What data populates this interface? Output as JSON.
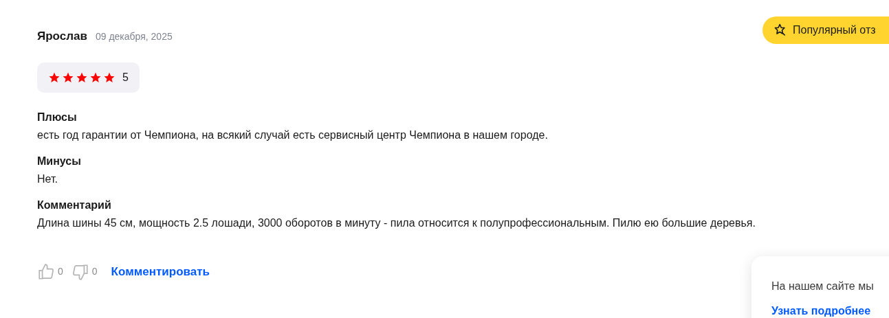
{
  "review": {
    "author": "Ярослав",
    "date": "09 декабря, 2025",
    "badge": "Популярный отз",
    "stars": 5,
    "rating": "5",
    "sections": [
      {
        "title": "Плюсы",
        "text": "есть год гарантии от Чемпиона, на всякий случай есть сервисный центр Чемпиона в нашем городе."
      },
      {
        "title": "Минусы",
        "text": "Нет."
      },
      {
        "title": "Комментарий",
        "text": "Длина шины 45 см, мощность 2.5 лошади, 3000 оборотов в минуту - пила относится к полупрофессиональным. Пилю ею большие деревья."
      }
    ],
    "likes": "0",
    "dislikes": "0",
    "comment_link": "Комментировать"
  },
  "cookie_notice": {
    "text": "На нашем сайте мы",
    "link": "Узнать подробнее"
  }
}
